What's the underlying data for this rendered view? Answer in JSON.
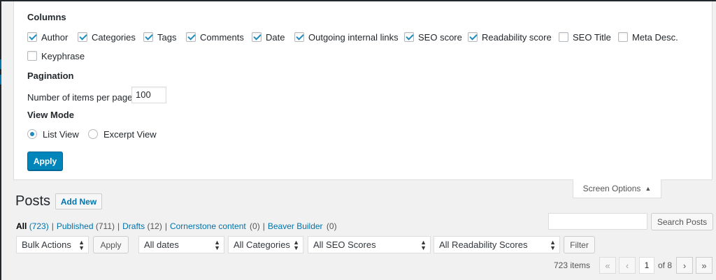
{
  "screen_options": {
    "columns_title": "Columns",
    "columns": [
      {
        "label": "Author",
        "checked": true
      },
      {
        "label": "Categories",
        "checked": true
      },
      {
        "label": "Tags",
        "checked": true
      },
      {
        "label": "Comments",
        "checked": true
      },
      {
        "label": "Date",
        "checked": true
      },
      {
        "label": "Outgoing internal links",
        "checked": true
      },
      {
        "label": "SEO score",
        "checked": true
      },
      {
        "label": "Readability score",
        "checked": true
      },
      {
        "label": "SEO Title",
        "checked": false
      },
      {
        "label": "Meta Desc.",
        "checked": false
      },
      {
        "label": "Keyphrase",
        "checked": false
      }
    ],
    "pagination_title": "Pagination",
    "items_per_page_label": "Number of items per page:",
    "items_per_page_value": "100",
    "view_mode_title": "View Mode",
    "view_modes": [
      {
        "label": "List View",
        "checked": true
      },
      {
        "label": "Excerpt View",
        "checked": false
      }
    ],
    "apply_label": "Apply",
    "tab_label": "Screen Options"
  },
  "posts": {
    "title": "Posts",
    "add_new_label": "Add New",
    "filters": [
      {
        "label": "All",
        "count": "(723)",
        "current": true
      },
      {
        "label": "Published",
        "count": "(711)",
        "current": false
      },
      {
        "label": "Drafts",
        "count": "(12)",
        "current": false
      },
      {
        "label": "Cornerstone content",
        "count": "(0)",
        "current": false
      },
      {
        "label": "Beaver Builder",
        "count": "(0)",
        "current": false
      }
    ],
    "separator": "|",
    "search_button_label": "Search Posts",
    "bulk_actions": "Bulk Actions",
    "apply_label": "Apply",
    "dates": "All dates",
    "categories": "All Categories",
    "seo_scores": "All SEO Scores",
    "readability_scores": "All Readability Scores",
    "filter_label": "Filter",
    "pagination": {
      "items": "723 items",
      "first": "«",
      "prev": "‹",
      "current_page": "1",
      "of_label": "of 8",
      "next": "›",
      "last": "»"
    }
  }
}
